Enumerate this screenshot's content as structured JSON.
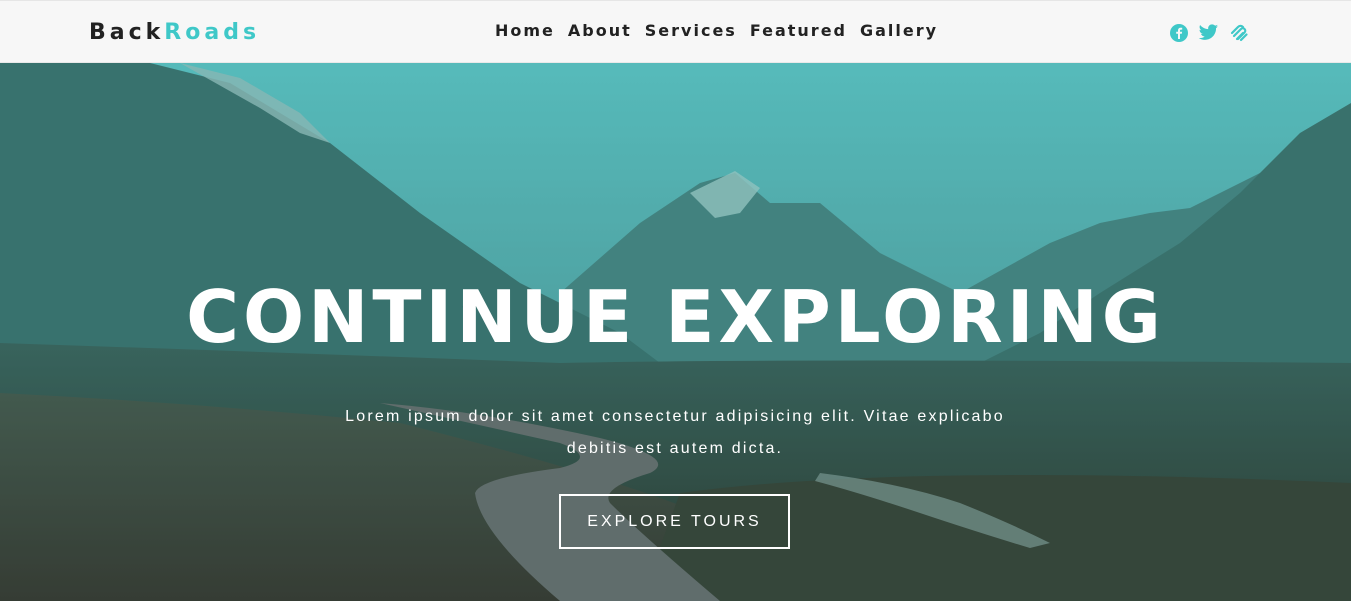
{
  "brand": {
    "part1": "Back",
    "part2": "Roads",
    "accent_color": "#3fc8c8"
  },
  "nav": {
    "links": [
      "Home",
      "About",
      "Services",
      "Featured",
      "Gallery"
    ]
  },
  "social": [
    {
      "icon": "facebook-icon"
    },
    {
      "icon": "twitter-icon"
    },
    {
      "icon": "squarespace-icon"
    }
  ],
  "hero": {
    "title": "CONTINUE EXPLORING",
    "text": "Lorem ipsum dolor sit amet consectetur adipisicing elit. Vitae explicabo debitis est autem dicta.",
    "button": "EXPLORE TOURS",
    "overlay_color": "#3fc8c8"
  }
}
